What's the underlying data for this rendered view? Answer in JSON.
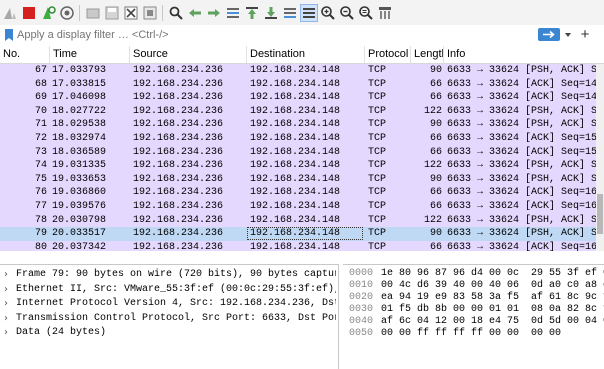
{
  "toolbar": {
    "icons": [
      "shark-fin-icon",
      "stop-icon",
      "restart-icon",
      "capture-options-icon",
      "open-file-icon",
      "save-file-icon",
      "close-file-icon",
      "reload-icon",
      "find-icon",
      "back-icon",
      "forward-icon",
      "go-to-packet-icon",
      "first-packet-icon",
      "last-packet-icon",
      "auto-scroll-icon",
      "colorize-icon",
      "zoom-in-icon",
      "zoom-out-icon",
      "zoom-reset-icon",
      "resize-columns-icon"
    ]
  },
  "filter": {
    "placeholder": "Apply a display filter … <Ctrl-/>",
    "plus_label": "+"
  },
  "columns": {
    "no": "No.",
    "time": "Time",
    "source": "Source",
    "destination": "Destination",
    "protocol": "Protocol",
    "length": "Length",
    "info": "Info"
  },
  "colors": {
    "row_bg": "#e5d8fe",
    "row_selected_bg": "#bfd8f3",
    "apply_button": "#3b86d3"
  },
  "packets": [
    {
      "no": "67",
      "time": "17.033793",
      "src": "192.168.234.236",
      "dst": "192.168.234.148",
      "proto": "TCP",
      "len": "90",
      "info": "6633 → 33624 [PSH, ACK] Seq=14"
    },
    {
      "no": "68",
      "time": "17.033815",
      "src": "192.168.234.236",
      "dst": "192.168.234.148",
      "proto": "TCP",
      "len": "66",
      "info": "6633 → 33624 [ACK] Seq=14"
    },
    {
      "no": "69",
      "time": "17.046098",
      "src": "192.168.234.236",
      "dst": "192.168.234.148",
      "proto": "TCP",
      "len": "66",
      "info": "6633 → 33624 [ACK] Seq=14"
    },
    {
      "no": "70",
      "time": "18.027722",
      "src": "192.168.234.236",
      "dst": "192.168.234.148",
      "proto": "TCP",
      "len": "122",
      "info": "6633 → 33624 [PSH, ACK] Se"
    },
    {
      "no": "71",
      "time": "18.029538",
      "src": "192.168.234.236",
      "dst": "192.168.234.148",
      "proto": "TCP",
      "len": "90",
      "info": "6633 → 33624 [PSH, ACK] Se"
    },
    {
      "no": "72",
      "time": "18.032974",
      "src": "192.168.234.236",
      "dst": "192.168.234.148",
      "proto": "TCP",
      "len": "66",
      "info": "6633 → 33624 [ACK] Seq=15"
    },
    {
      "no": "73",
      "time": "18.036589",
      "src": "192.168.234.236",
      "dst": "192.168.234.148",
      "proto": "TCP",
      "len": "66",
      "info": "6633 → 33624 [ACK] Seq=15"
    },
    {
      "no": "74",
      "time": "19.031335",
      "src": "192.168.234.236",
      "dst": "192.168.234.148",
      "proto": "TCP",
      "len": "122",
      "info": "6633 → 33624 [PSH, ACK] Se"
    },
    {
      "no": "75",
      "time": "19.033653",
      "src": "192.168.234.236",
      "dst": "192.168.234.148",
      "proto": "TCP",
      "len": "90",
      "info": "6633 → 33624 [PSH, ACK] Se"
    },
    {
      "no": "76",
      "time": "19.036860",
      "src": "192.168.234.236",
      "dst": "192.168.234.148",
      "proto": "TCP",
      "len": "66",
      "info": "6633 → 33624 [ACK] Seq=16"
    },
    {
      "no": "77",
      "time": "19.039576",
      "src": "192.168.234.236",
      "dst": "192.168.234.148",
      "proto": "TCP",
      "len": "66",
      "info": "6633 → 33624 [ACK] Seq=16"
    },
    {
      "no": "78",
      "time": "20.030798",
      "src": "192.168.234.236",
      "dst": "192.168.234.148",
      "proto": "TCP",
      "len": "122",
      "info": "6633 → 33624 [PSH, ACK] Se"
    },
    {
      "no": "79",
      "time": "20.033517",
      "src": "192.168.234.236",
      "dst": "192.168.234.148",
      "proto": "TCP",
      "len": "90",
      "info": "6633 → 33624 [PSH, ACK] Se"
    },
    {
      "no": "80",
      "time": "20.037342",
      "src": "192.168.234.236",
      "dst": "192.168.234.148",
      "proto": "TCP",
      "len": "66",
      "info": "6633 → 33624 [ACK] Seq=16"
    }
  ],
  "details": [
    "Frame 79: 90 bytes on wire (720 bits), 90 bytes captured",
    "Ethernet II, Src: VMware_55:3f:ef (00:0c:29:55:3f:ef), Ds",
    "Internet Protocol Version 4, Src: 192.168.234.236, Dst: 1",
    "Transmission Control Protocol, Src Port: 6633, Dst Port:",
    "Data (24 bytes)"
  ],
  "hex": [
    {
      "off": "0000",
      "bytes": "1e 80 96 87 96 d4 00 0c  29 55 3f ef 08"
    },
    {
      "off": "0010",
      "bytes": "00 4c d6 39 40 00 40 06  0d a0 c0 a8 ea"
    },
    {
      "off": "0020",
      "bytes": "ea 94 19 e9 83 58 3a f5  af 61 8c 9c f8"
    },
    {
      "off": "0030",
      "bytes": "01 f5 db 8b 00 00 01 01  08 0a 82 8c f3"
    },
    {
      "off": "0040",
      "bytes": "af 6c 04 12 00 18 e4 75  0d 5d 00 04 00"
    },
    {
      "off": "0050",
      "bytes": "00 00 ff ff ff ff 00 00  00 00"
    }
  ],
  "selected_no": "79"
}
